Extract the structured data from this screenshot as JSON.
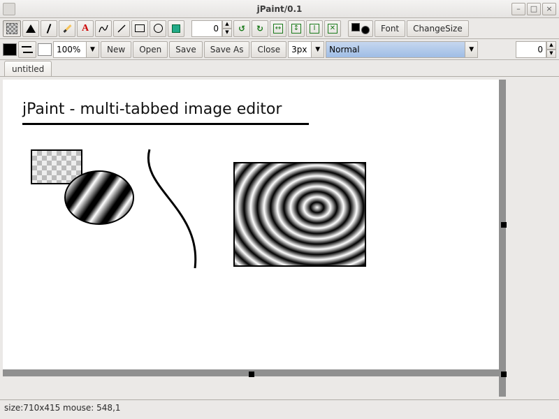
{
  "window": {
    "title": "jPaint/0.1"
  },
  "toolbar1": {
    "spinner1": "0",
    "font_label": "Font",
    "changesize_label": "ChangeSize"
  },
  "toolbar2": {
    "zoom": "100%",
    "new_label": "New",
    "open_label": "Open",
    "save_label": "Save",
    "saveas_label": "Save As",
    "close_label": "Close",
    "stroke": "3px",
    "mode": "Normal",
    "spinner2": "0"
  },
  "tabs": {
    "tab1": "untitled"
  },
  "canvas": {
    "heading": "jPaint - multi-tabbed image editor"
  },
  "status": {
    "text": "size:710x415 mouse: 548,1"
  }
}
